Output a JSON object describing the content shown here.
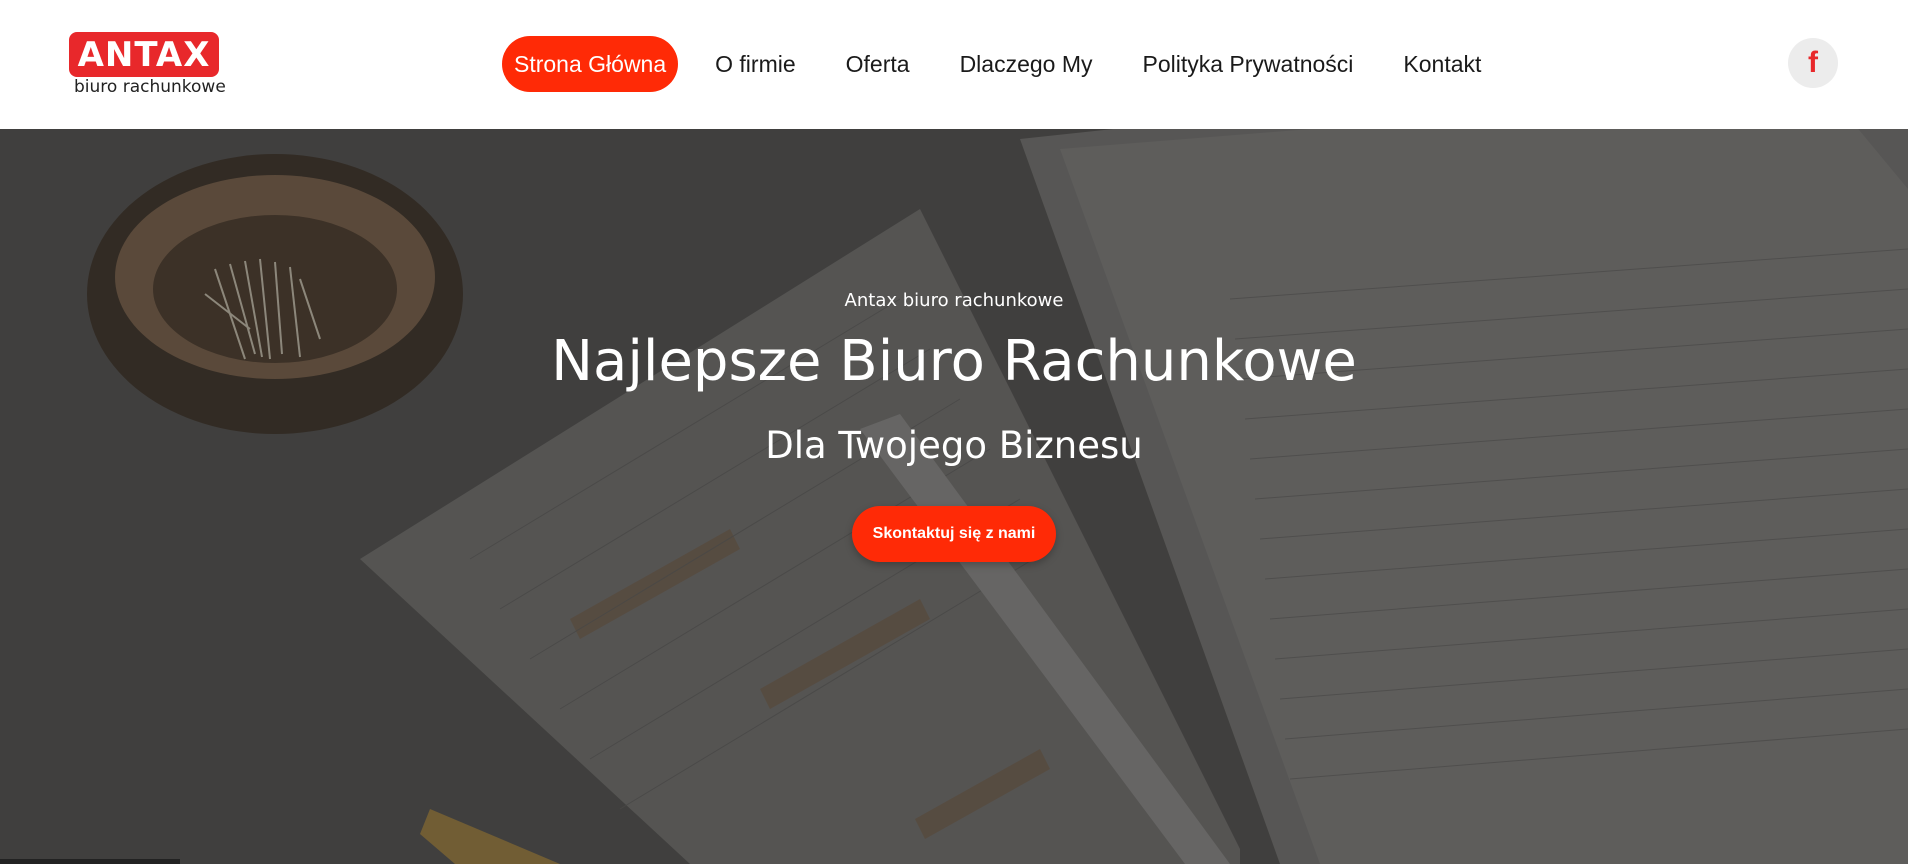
{
  "logo": {
    "brand": "ANTAX",
    "tagline": "biuro rachunkowe"
  },
  "nav": [
    {
      "label": "Strona Główna",
      "active": true
    },
    {
      "label": "O firmie",
      "active": false
    },
    {
      "label": "Oferta",
      "active": false
    },
    {
      "label": "Dlaczego My",
      "active": false
    },
    {
      "label": "Polityka Prywatności",
      "active": false
    },
    {
      "label": "Kontakt",
      "active": false
    }
  ],
  "social": {
    "facebook_glyph": "f",
    "icon": "facebook-icon"
  },
  "hero": {
    "eyebrow": "Antax biuro rachunkowe",
    "title": "Najlepsze Biuro Rachunkowe",
    "subtitle": "Dla Twojego Biznesu",
    "cta_label": "Skontaktuj się z nami"
  },
  "colors": {
    "accent": "#ff2a06",
    "logo_red": "#e8282b",
    "hero_overlay": "#4f4e4c"
  }
}
